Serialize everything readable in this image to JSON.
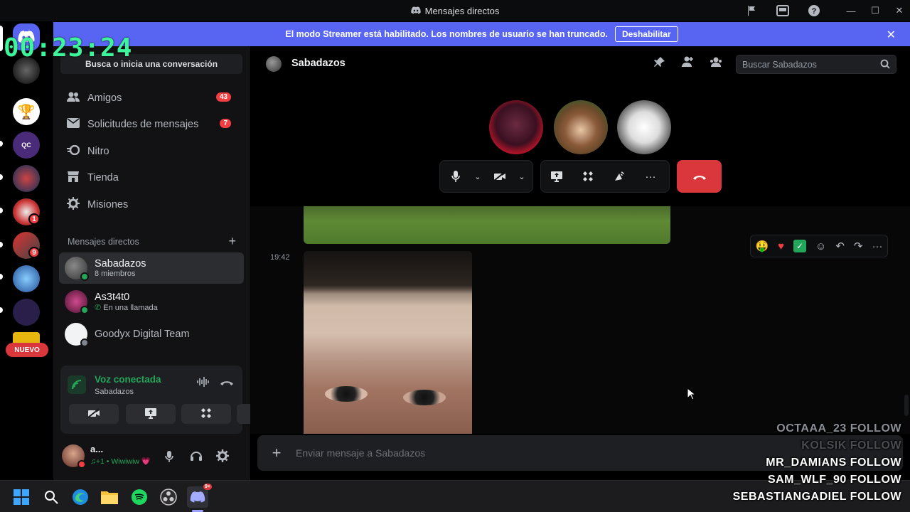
{
  "window": {
    "title": "Mensajes directos"
  },
  "banner": {
    "text": "El modo Streamer está habilitado. Los nombres de usuario se han truncado.",
    "button": "Deshabilitar"
  },
  "overlay": {
    "timer": "00:23:24",
    "follows": [
      "OCTAAA_23 FOLLOW",
      "KOLSIK FOLLOW",
      "MR_DAMIANS FOLLOW",
      "SAM_WLF_90 FOLLOW",
      "SEBASTIANGADIEL FOLLOW"
    ]
  },
  "rail": {
    "new_label": "NUEVO",
    "badges": [
      "1",
      "9"
    ]
  },
  "sidebar": {
    "search_label": "Busca o inicia una conversación",
    "nav": [
      {
        "label": "Amigos",
        "icon": "friends-icon",
        "badge": "43"
      },
      {
        "label": "Solicitudes de mensajes",
        "icon": "mail-icon",
        "badge": "7"
      },
      {
        "label": "Nitro",
        "icon": "nitro-icon",
        "badge": ""
      },
      {
        "label": "Tienda",
        "icon": "shop-icon",
        "badge": ""
      },
      {
        "label": "Misiones",
        "icon": "quests-icon",
        "badge": ""
      }
    ],
    "dm_header": "Mensajes directos",
    "dms": [
      {
        "name": "Sabadazos",
        "sub": "8 miembros"
      },
      {
        "name": "As3t4t0",
        "sub": "En una llamada"
      },
      {
        "name": "Goodyx Digital Team",
        "sub": ""
      }
    ],
    "voice": {
      "status": "Voz conectada",
      "channel": "Sabadazos"
    },
    "user": {
      "name": "a...",
      "status": "♫+1 • Wiwiwiw 💗"
    }
  },
  "channel": {
    "name": "Sabadazos",
    "search_placeholder": "Buscar Sabadazos"
  },
  "messages": {
    "time": "19:42"
  },
  "composer": {
    "placeholder": "Enviar mensaje a Sabadazos"
  },
  "colors": {
    "accent": "#5865f2",
    "danger": "#da373c",
    "online": "#23a55a",
    "timer": "#3df59b"
  }
}
